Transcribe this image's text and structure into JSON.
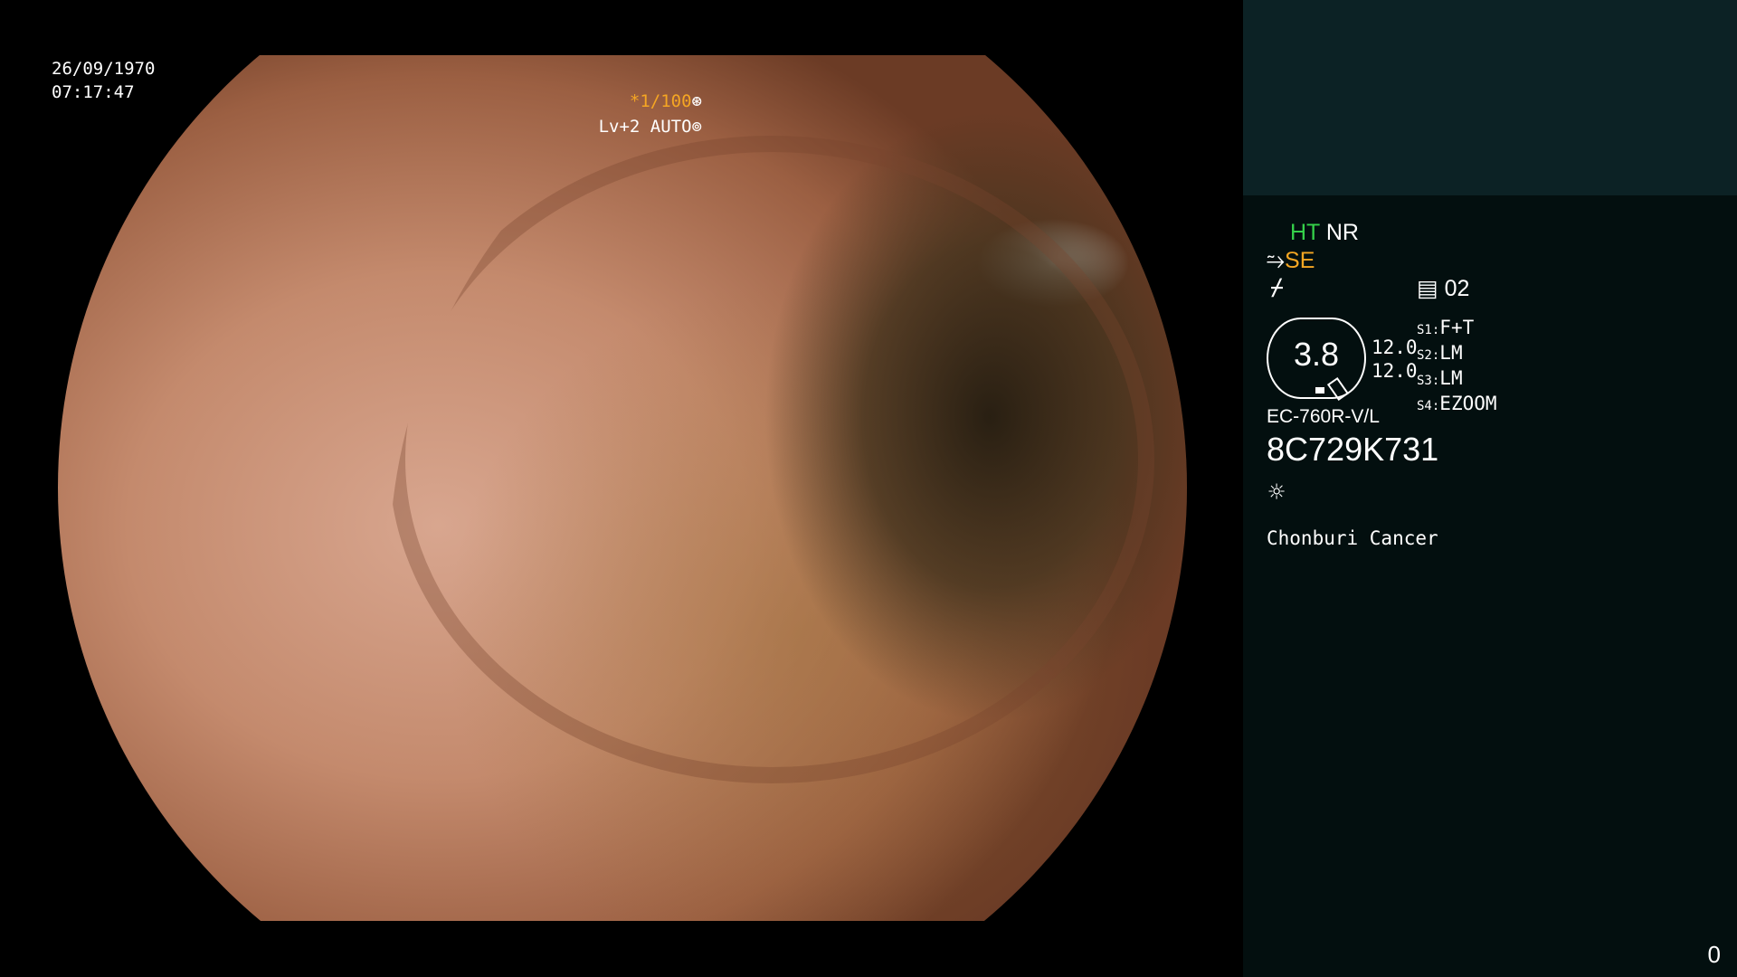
{
  "datetime": {
    "date": "26/09/1970",
    "time": "07:17:47"
  },
  "shutter": {
    "speed": "*1/100",
    "speed_icon": "shutter-icon",
    "level": "Lv+2 AUTO",
    "level_icon": "iris-icon"
  },
  "panel": {
    "ht": "HT",
    "nr": "NR",
    "se": "SE",
    "se_icon": "structure-enhance-icon",
    "struct_icon": "edge-enhance-icon",
    "memory_icon": "memory-icon",
    "memory": "02",
    "zoom": "3.8",
    "enh_a": "12.0",
    "enh_b": "12.0",
    "settings": [
      {
        "label": "S1",
        "value": "F+T"
      },
      {
        "label": "S2",
        "value": "LM"
      },
      {
        "label": "S3",
        "value": "LM"
      },
      {
        "label": "S4",
        "value": "EZOOM"
      }
    ],
    "scope_model": "EC-760R-V/L",
    "serial": "8C729K731",
    "light_icon": "light-source-icon",
    "hospital": "Chonburi Cancer",
    "counter": "0"
  },
  "colors": {
    "panel_top": "#0c2225",
    "panel_bg": "#030f0f",
    "accent_orange": "#f5a623",
    "accent_green": "#35d14a"
  }
}
